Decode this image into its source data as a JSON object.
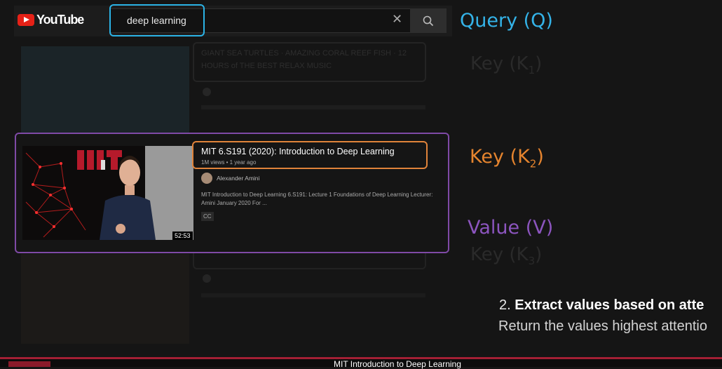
{
  "youtube": {
    "logo_text": "YouTube",
    "search_value": "deep learning",
    "clear_symbol": "✕"
  },
  "labels": {
    "query": "Query (Q)",
    "key1": "Key (K",
    "key1_sub": "1",
    "key2": "Key (K",
    "key2_sub": "2",
    "key3": "Key (K",
    "key3_sub": "3",
    "value": "Value (V)"
  },
  "results": [
    {
      "title": "GIANT SEA TURTLES · AMAZING CORAL REEF FISH · 12",
      "title2": "HOURS of THE BEST RELAX MUSIC"
    },
    {
      "title": "MIT 6.S191 (2020): Introduction to Deep Learning",
      "meta": "1M views • 1 year ago",
      "channel": "Alexander Amini",
      "description": "MIT Introduction to Deep Learning 6.S191: Lecture 1 Foundations of Deep Learning Lecturer: Amini January 2020 For ...",
      "badge": "CC",
      "duration": "52:53"
    }
  ],
  "explanation": {
    "step_number": "2.",
    "step_title": "Extract values based on atte",
    "step_desc": "Return the values highest attentio"
  },
  "footer": {
    "title": "MIT Introduction to Deep Learning"
  },
  "colors": {
    "query": "#34b3e8",
    "key": "#e5842e",
    "value": "#8c55bf",
    "footer_accent": "#a31f34"
  }
}
